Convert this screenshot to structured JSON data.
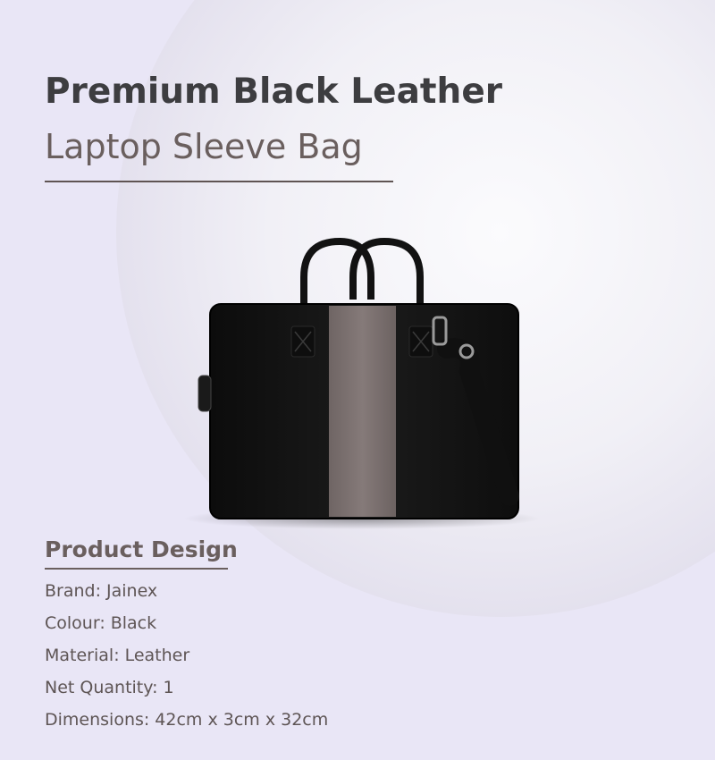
{
  "title": {
    "line1": "Premium Black Leather",
    "line2": "Laptop Sleeve Bag"
  },
  "product_image": {
    "subject": "laptop-bag-icon",
    "colors": {
      "body": "#141414",
      "stripe": "#7b7170",
      "strap": "#101010",
      "hardware": "#9a9a9a"
    }
  },
  "section": {
    "title": "Product Design",
    "specs": [
      {
        "label": "Brand:",
        "value": "Jainex"
      },
      {
        "label": "Colour:",
        "value": "Black"
      },
      {
        "label": "Material:",
        "value": "Leather"
      },
      {
        "label": "Net Quantity:",
        "value": "1"
      },
      {
        "label": "Dimensions:",
        "value": "42cm x 3cm x 32cm"
      }
    ]
  },
  "colors": {
    "background_light": "#f5f4fa",
    "background_lavender": "#e9e6f6",
    "title_dark": "#3d3d40",
    "title_brown": "#6a5f5e",
    "text": "#5e5555"
  }
}
